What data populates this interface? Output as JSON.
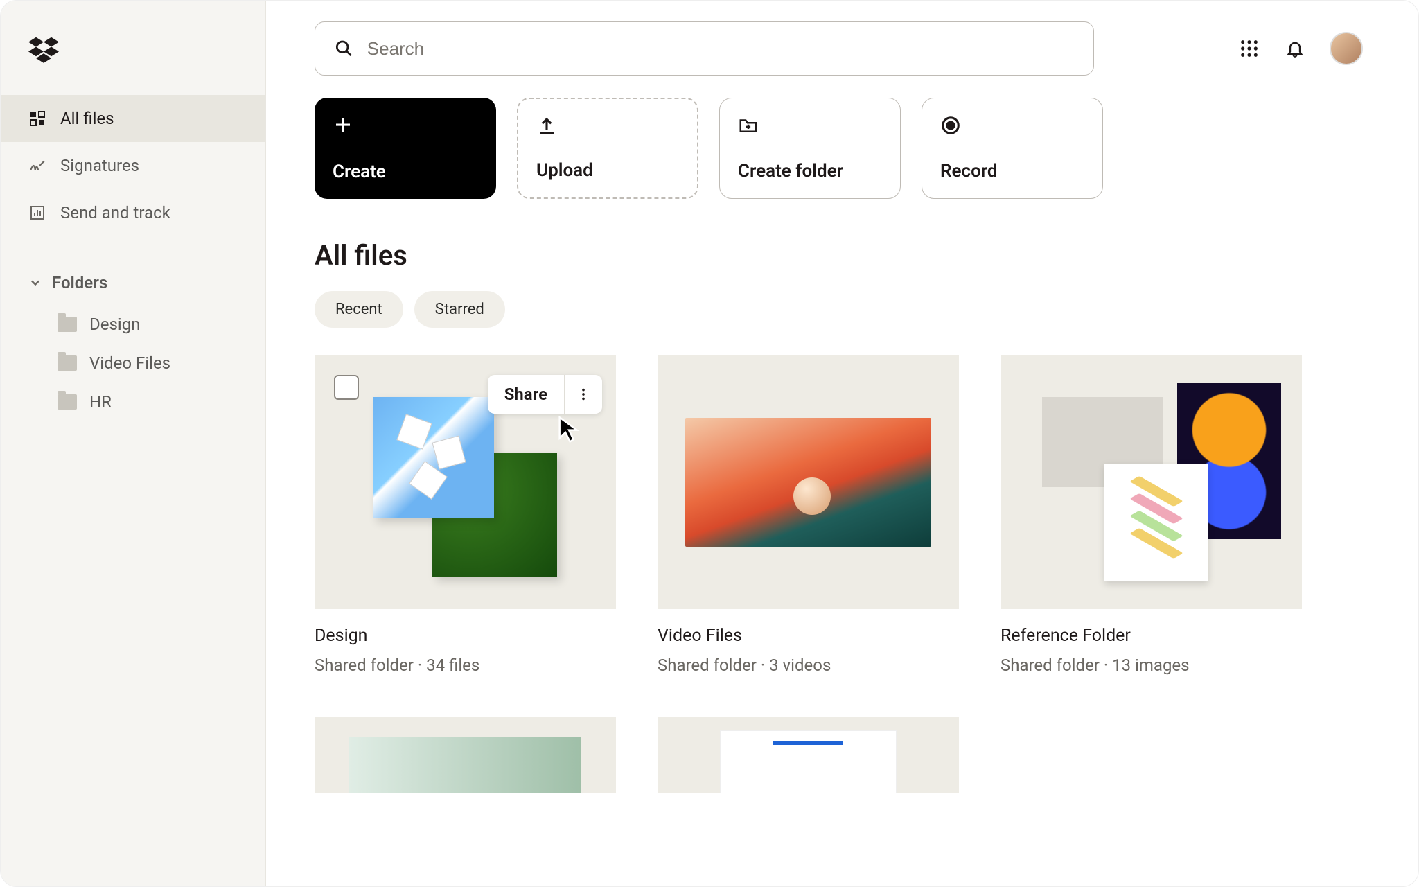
{
  "search": {
    "placeholder": "Search"
  },
  "sidebar": {
    "nav": [
      {
        "label": "All files"
      },
      {
        "label": "Signatures"
      },
      {
        "label": "Send and track"
      }
    ],
    "folders_header": "Folders",
    "folders": [
      {
        "label": "Design"
      },
      {
        "label": "Video Files"
      },
      {
        "label": "HR"
      }
    ]
  },
  "actions": {
    "create": "Create",
    "upload": "Upload",
    "create_folder": "Create folder",
    "record": "Record"
  },
  "page_title": "All files",
  "filters": {
    "recent": "Recent",
    "starred": "Starred"
  },
  "hover": {
    "share": "Share"
  },
  "cards": [
    {
      "title": "Design",
      "meta": "Shared folder · 34 files"
    },
    {
      "title": "Video Files",
      "meta": "Shared folder · 3 videos"
    },
    {
      "title": "Reference Folder",
      "meta": "Shared folder · 13 images"
    }
  ]
}
